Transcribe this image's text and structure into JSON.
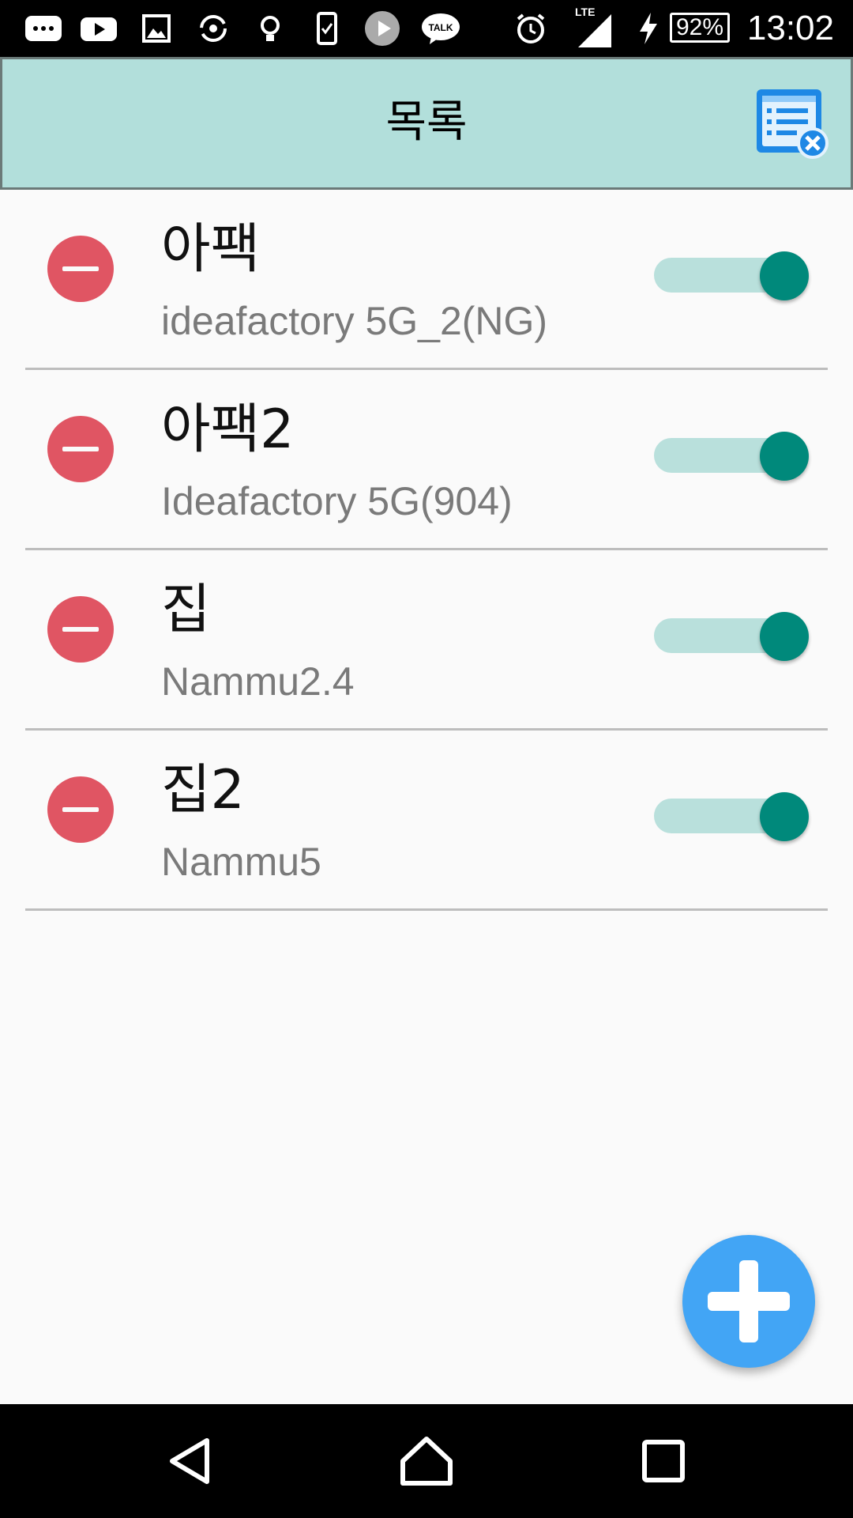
{
  "status_bar": {
    "battery": "92%",
    "time": "13:02",
    "network": "LTE"
  },
  "app_bar": {
    "title": "목록",
    "clear_list_icon": "clear-list-icon"
  },
  "networks": [
    {
      "name": "아팩",
      "ssid": "ideafactory 5G_2(NG)",
      "enabled": true
    },
    {
      "name": "아팩2",
      "ssid": "Ideafactory 5G(904)",
      "enabled": true
    },
    {
      "name": "집",
      "ssid": "Nammu2.4",
      "enabled": true
    },
    {
      "name": "집2",
      "ssid": "Nammu5",
      "enabled": true
    }
  ],
  "colors": {
    "app_bar": "#b2dfdb",
    "remove": "#e05563",
    "toggle_on_thumb": "#00897b",
    "toggle_on_track": "#b9e0dc",
    "fab": "#42a5f5"
  },
  "fab": {
    "icon": "plus-icon"
  },
  "nav_bar": {
    "icons": [
      "back-icon",
      "home-icon",
      "recents-icon"
    ]
  }
}
